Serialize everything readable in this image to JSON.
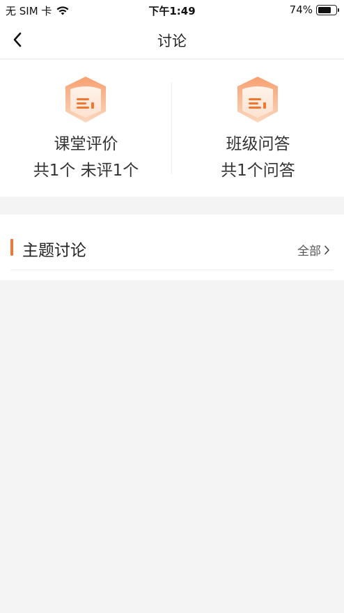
{
  "status": {
    "carrier": "无 SIM 卡",
    "time": "下午1:49",
    "battery": "74%",
    "battery_level": 0.74
  },
  "nav": {
    "title": "讨论",
    "back_icon": "chevron-left-icon"
  },
  "cards": [
    {
      "title": "课堂评价",
      "subtitle": "共1个  未评1个",
      "icon": "evaluation-box-icon"
    },
    {
      "title": "班级问答",
      "subtitle": "共1个问答",
      "icon": "qa-box-icon"
    }
  ],
  "topic": {
    "title": "主题讨论",
    "all_label": "全部",
    "accent_color": "#f0772f"
  }
}
